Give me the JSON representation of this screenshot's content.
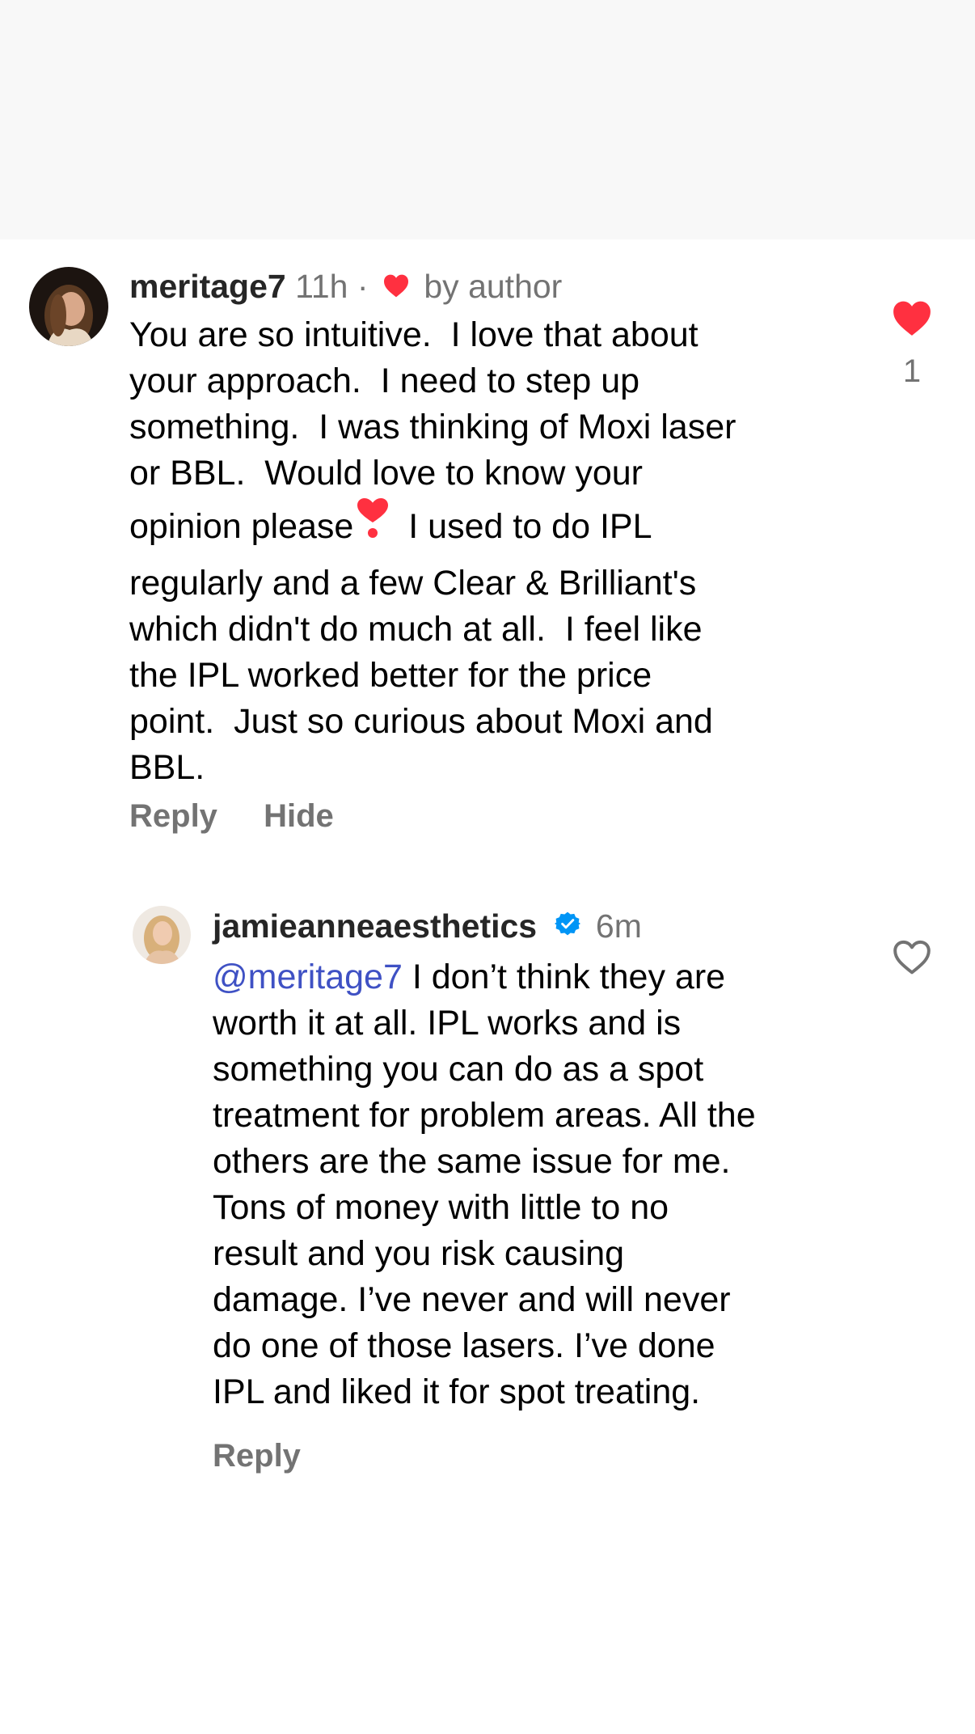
{
  "comments": [
    {
      "username": "meritage7",
      "time": "11h",
      "separator": "·",
      "author_like_label": "by author",
      "text_parts": {
        "before_emoji": "You are so intuitive.  I love that about\nyour approach.  I need to step up\nsomething.  I was thinking of Moxi laser\nor BBL.  Would love to know your\nopinion please",
        "after_emoji": " I used to do IPL\nregularly and a few Clear & Brilliant's\nwhich didn't do much at all.  I feel like\nthe IPL worked better for the price\npoint.  Just so curious about Moxi and\nBBL."
      },
      "actions": {
        "reply": "Reply",
        "hide": "Hide"
      },
      "like_count": "1",
      "liked": true,
      "verified": false
    },
    {
      "username": "jamieanneaesthetics",
      "time": "6m",
      "verified": true,
      "mention": "@meritage7",
      "text": " I don’t think they are\nworth it at all. IPL works and is\nsomething you can do as a spot\ntreatment for problem areas. All the\nothers are the same issue for me.\nTons of money with little to no\nresult and you risk causing\ndamage. I’ve never and will never\ndo one of those lasers. I’ve done\nIPL and liked it for spot treating.",
      "actions": {
        "reply": "Reply"
      },
      "liked": false
    }
  ],
  "colors": {
    "like_red": "#ff3040",
    "verified_blue": "#0095f6",
    "mention": "#3f51c4",
    "muted": "#737373"
  },
  "icons": {
    "liked": "heart-filled-icon",
    "unliked": "heart-outline-icon",
    "verified": "verified-badge-icon"
  }
}
